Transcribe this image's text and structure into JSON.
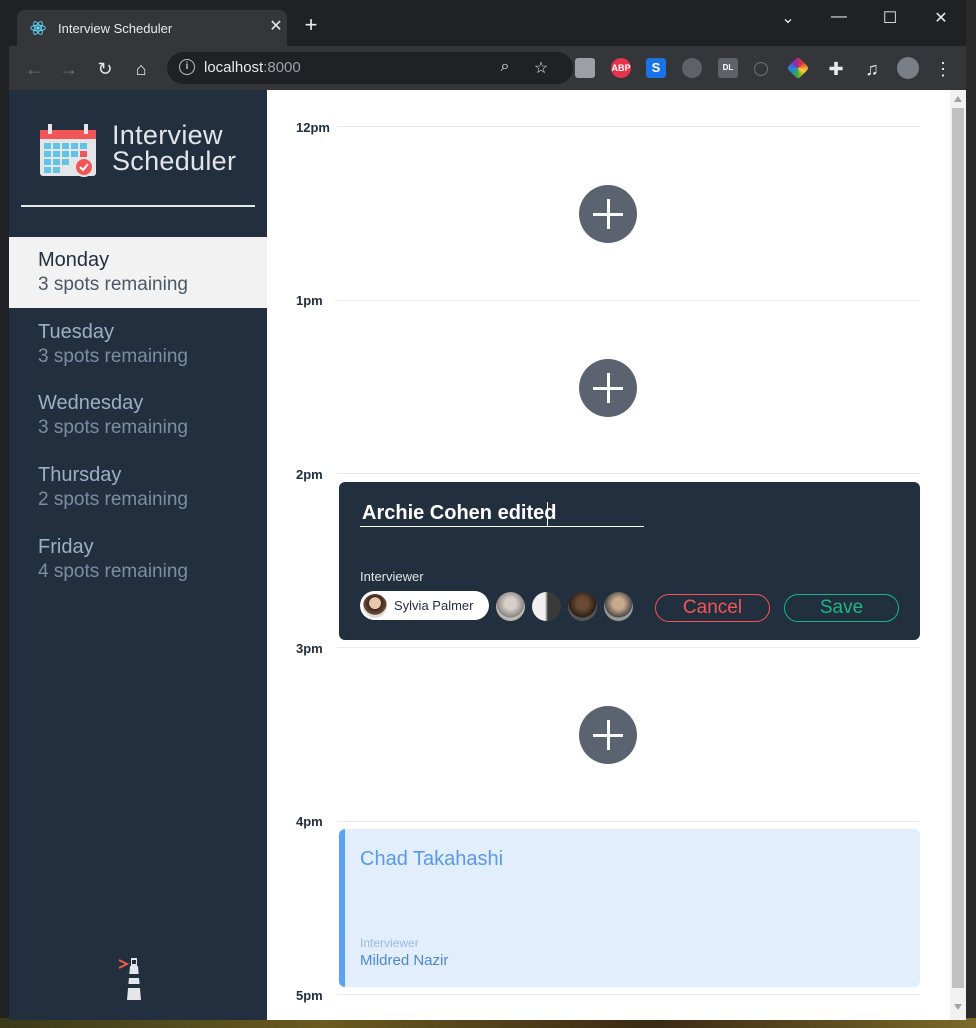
{
  "browser": {
    "tab_title": "Interview Scheduler",
    "tab_close": "✕",
    "new_tab": "+",
    "window_controls": {
      "minimize": "—",
      "maximize": "☐",
      "close": "✕",
      "tabsearch": "⌄"
    },
    "url_host": "localhost",
    "url_port": ":8000",
    "extensions": [
      "ABP",
      "S",
      "DL"
    ]
  },
  "app": {
    "brand_line1": "Interview",
    "brand_line2": "Scheduler",
    "days": [
      {
        "name": "Monday",
        "spots": "3 spots remaining",
        "selected": true
      },
      {
        "name": "Tuesday",
        "spots": "3 spots remaining"
      },
      {
        "name": "Wednesday",
        "spots": "3 spots remaining"
      },
      {
        "name": "Thursday",
        "spots": "2 spots remaining"
      },
      {
        "name": "Friday",
        "spots": "4 spots remaining"
      }
    ],
    "times": [
      "12pm",
      "1pm",
      "2pm",
      "3pm",
      "4pm",
      "5pm"
    ],
    "form": {
      "student_value": "Archie Cohen edited",
      "interviewer_label": "Interviewer",
      "selected_interviewer": "Sylvia Palmer",
      "cancel_label": "Cancel",
      "save_label": "Save"
    },
    "appointment": {
      "student": "Chad Takahashi",
      "interviewer_label": "Interviewer",
      "interviewer_name": "Mildred Nazir"
    }
  },
  "colors": {
    "sidebar": "#222f3e",
    "accent_cancel": "#f25555",
    "accent_save": "#1db586",
    "appointment_border": "#5aa4f5"
  }
}
